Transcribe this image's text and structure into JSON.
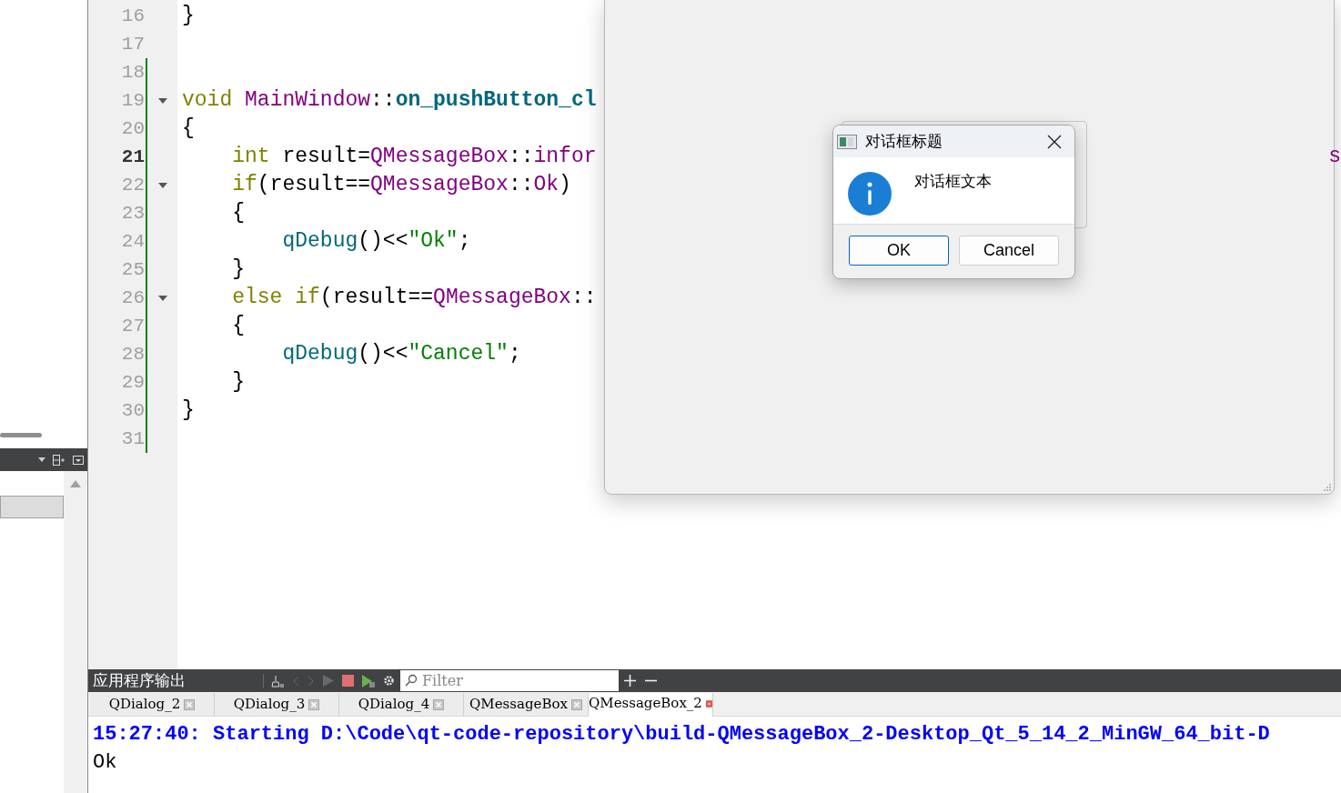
{
  "editor": {
    "lines": [
      {
        "number": "16",
        "current": false,
        "changed": false,
        "fold": false,
        "tokens": [
          {
            "kind": "plain",
            "text": "}"
          }
        ]
      },
      {
        "number": "17",
        "current": false,
        "changed": false,
        "fold": false
      },
      {
        "number": "18",
        "current": false,
        "changed": true,
        "fold": false
      },
      {
        "number": "19",
        "current": false,
        "changed": true,
        "fold": true,
        "tokens": [
          {
            "kind": "keyword",
            "text": "void"
          },
          {
            "kind": "type",
            "text": " MainWindow"
          },
          {
            "kind": "plain",
            "text": "::"
          },
          {
            "kind": "function",
            "text": "on_pushButton_cl"
          }
        ]
      },
      {
        "number": "20",
        "current": false,
        "changed": true,
        "fold": false,
        "tokens": [
          {
            "kind": "plain",
            "text": "{"
          }
        ]
      },
      {
        "number": "21",
        "current": true,
        "changed": true,
        "fold": false,
        "tokens": [
          {
            "kind": "keyword",
            "text": "    int"
          },
          {
            "kind": "plain",
            "text": " result="
          },
          {
            "kind": "type",
            "text": "QMessageBox"
          },
          {
            "kind": "plain",
            "text": "::"
          },
          {
            "kind": "type",
            "text": "infor"
          }
        ]
      },
      {
        "number": "22",
        "current": false,
        "changed": true,
        "fold": true,
        "tokens": [
          {
            "kind": "keyword",
            "text": "    if"
          },
          {
            "kind": "plain",
            "text": "(result=="
          },
          {
            "kind": "type",
            "text": "QMessageBox"
          },
          {
            "kind": "plain",
            "text": "::"
          },
          {
            "kind": "type",
            "text": "Ok"
          },
          {
            "kind": "plain",
            "text": ")"
          }
        ]
      },
      {
        "number": "23",
        "current": false,
        "changed": true,
        "fold": false,
        "tokens": [
          {
            "kind": "plain",
            "text": "    {"
          }
        ]
      },
      {
        "number": "24",
        "current": false,
        "changed": true,
        "fold": false,
        "tokens": [
          {
            "kind": "call",
            "text": "        qDebug"
          },
          {
            "kind": "plain",
            "text": "()<<"
          },
          {
            "kind": "string",
            "text": "\"Ok\""
          },
          {
            "kind": "plain",
            "text": ";"
          }
        ]
      },
      {
        "number": "25",
        "current": false,
        "changed": true,
        "fold": false,
        "tokens": [
          {
            "kind": "plain",
            "text": "    }"
          }
        ]
      },
      {
        "number": "26",
        "current": false,
        "changed": true,
        "fold": true,
        "tokens": [
          {
            "kind": "keyword",
            "text": "    else"
          },
          {
            "kind": "keyword",
            "text": " if"
          },
          {
            "kind": "plain",
            "text": "(result=="
          },
          {
            "kind": "type",
            "text": "QMessageBox"
          },
          {
            "kind": "plain",
            "text": "::"
          }
        ]
      },
      {
        "number": "27",
        "current": false,
        "changed": true,
        "fold": false,
        "tokens": [
          {
            "kind": "plain",
            "text": "    {"
          }
        ]
      },
      {
        "number": "28",
        "current": false,
        "changed": true,
        "fold": false,
        "tokens": [
          {
            "kind": "call",
            "text": "        qDebug"
          },
          {
            "kind": "plain",
            "text": "()<<"
          },
          {
            "kind": "string",
            "text": "\"Cancel\""
          },
          {
            "kind": "plain",
            "text": ";"
          }
        ]
      },
      {
        "number": "29",
        "current": false,
        "changed": true,
        "fold": false,
        "tokens": [
          {
            "kind": "plain",
            "text": "    }"
          }
        ]
      },
      {
        "number": "30",
        "current": false,
        "changed": true,
        "fold": false,
        "tokens": [
          {
            "kind": "plain",
            "text": "}"
          }
        ]
      },
      {
        "number": "31",
        "current": false,
        "changed": true,
        "fold": false
      }
    ],
    "right_fragment": "s"
  },
  "dialog": {
    "title": "对话框标题",
    "text": "对话框文本",
    "buttons": [
      {
        "label": "OK",
        "default": true
      },
      {
        "label": "Cancel",
        "default": false
      }
    ]
  },
  "output": {
    "title": "应用程序输出",
    "filter_placeholder": "Filter",
    "tabs": [
      {
        "label": "QDialog_2",
        "selected": false
      },
      {
        "label": "QDialog_3",
        "selected": false
      },
      {
        "label": "QDialog_4",
        "selected": false
      },
      {
        "label": "QMessageBox",
        "selected": false
      },
      {
        "label": "QMessageBox_2",
        "selected": true
      }
    ],
    "lines": [
      {
        "kind": "status",
        "text": "15:27:40: Starting D:\\Code\\qt-code-repository\\build-QMessageBox_2-Desktop_Qt_5_14_2_MinGW_64_bit-D"
      },
      {
        "kind": "plain",
        "text": "Ok"
      }
    ]
  }
}
